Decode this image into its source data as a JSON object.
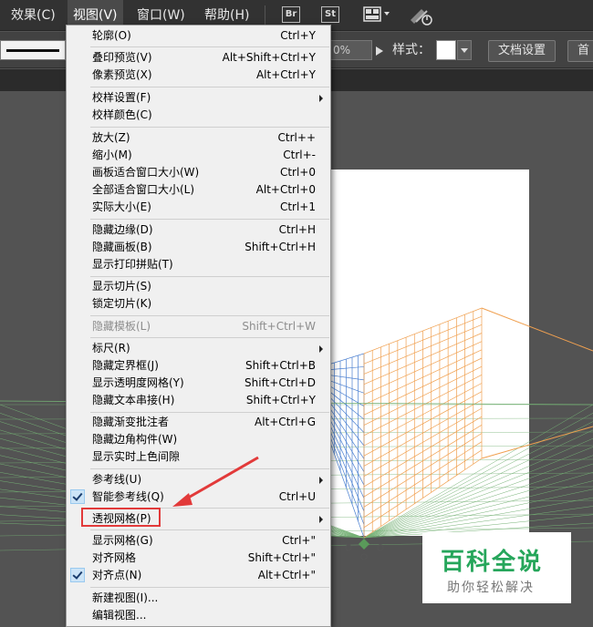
{
  "menubar": {
    "items": [
      "效果(C)",
      "视图(V)",
      "窗口(W)",
      "帮助(H)"
    ],
    "icons": [
      {
        "name": "bridge-icon",
        "text": "Br"
      },
      {
        "name": "stock-icon",
        "text": "St"
      },
      {
        "name": "arrange-documents-icon",
        "text": ""
      },
      {
        "name": "gpu-performance-icon",
        "text": ""
      }
    ]
  },
  "control_bar": {
    "opacity_value": "0%",
    "style_label": "样式：",
    "document_setup_label": "文档设置",
    "preferences_label": "首"
  },
  "view_menu": {
    "items": [
      {
        "label": "轮廓(O)",
        "shortcut": "Ctrl+Y"
      },
      {
        "label": "叠印预览(V)",
        "shortcut": "Alt+Shift+Ctrl+Y"
      },
      {
        "label": "像素预览(X)",
        "shortcut": "Alt+Ctrl+Y"
      },
      {
        "label": "校样设置(F)",
        "shortcut": ""
      },
      {
        "label": "校样颜色(C)",
        "shortcut": ""
      },
      {
        "label": "放大(Z)",
        "shortcut": "Ctrl++"
      },
      {
        "label": "缩小(M)",
        "shortcut": "Ctrl+-"
      },
      {
        "label": "画板适合窗口大小(W)",
        "shortcut": "Ctrl+0"
      },
      {
        "label": "全部适合窗口大小(L)",
        "shortcut": "Alt+Ctrl+0"
      },
      {
        "label": "实际大小(E)",
        "shortcut": "Ctrl+1"
      },
      {
        "label": "隐藏边缘(D)",
        "shortcut": "Ctrl+H"
      },
      {
        "label": "隐藏画板(B)",
        "shortcut": "Shift+Ctrl+H"
      },
      {
        "label": "显示打印拼贴(T)",
        "shortcut": ""
      },
      {
        "label": "显示切片(S)",
        "shortcut": ""
      },
      {
        "label": "锁定切片(K)",
        "shortcut": ""
      },
      {
        "label": "隐藏模板(L)",
        "shortcut": "Shift+Ctrl+W"
      },
      {
        "label": "标尺(R)",
        "shortcut": ""
      },
      {
        "label": "隐藏定界框(J)",
        "shortcut": "Shift+Ctrl+B"
      },
      {
        "label": "显示透明度网格(Y)",
        "shortcut": "Shift+Ctrl+D"
      },
      {
        "label": "隐藏文本串接(H)",
        "shortcut": "Shift+Ctrl+Y"
      },
      {
        "label": "隐藏渐变批注者",
        "shortcut": "Alt+Ctrl+G"
      },
      {
        "label": "隐藏边角构件(W)",
        "shortcut": ""
      },
      {
        "label": "显示实时上色间隙",
        "shortcut": ""
      },
      {
        "label": "参考线(U)",
        "shortcut": ""
      },
      {
        "label": "智能参考线(Q)",
        "shortcut": "Ctrl+U"
      },
      {
        "label": "透视网格(P)",
        "shortcut": ""
      },
      {
        "label": "显示网格(G)",
        "shortcut": "Ctrl+\""
      },
      {
        "label": "对齐网格",
        "shortcut": "Shift+Ctrl+\""
      },
      {
        "label": "对齐点(N)",
        "shortcut": "Alt+Ctrl+\""
      },
      {
        "label": "新建视图(I)...",
        "shortcut": ""
      },
      {
        "label": "编辑视图...",
        "shortcut": ""
      }
    ]
  },
  "watermark": {
    "title": "百科全说",
    "subtitle": "助你轻松解决"
  },
  "colors": {
    "menubar_bg": "#323232",
    "app_bg": "#535353",
    "grid_orange": "#f0a050",
    "grid_blue": "#4a7fd0",
    "grid_green": "#74b074",
    "highlight_red": "#e23a3a",
    "watermark_green": "#26a65b"
  }
}
